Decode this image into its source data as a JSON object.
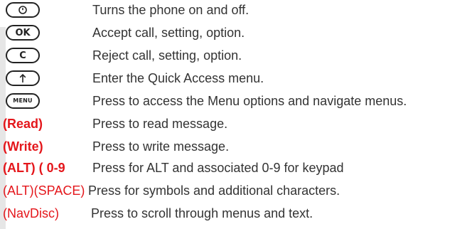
{
  "rows": [
    {
      "key_icon": "power-icon",
      "description": "Turns the phone on and off."
    },
    {
      "key_label": "OK",
      "description": "Accept call, setting, option."
    },
    {
      "key_label": "C",
      "description": "Reject call, setting, option."
    },
    {
      "key_icon": "up-arrow-icon",
      "description": "Enter the Quick Access menu."
    },
    {
      "key_label": "MENU",
      "description": "Press to access the Menu options and navigate menus."
    },
    {
      "label": "(Read)",
      "description": "Press to read message."
    },
    {
      "label": "(Write)",
      "description": "Press to write message."
    },
    {
      "label": "(ALT) ( 0-9",
      "description": "Press for ALT and associated 0-9 for keypad"
    },
    {
      "label": "(ALT)(SPACE)",
      "description": "Press for symbols and additional characters."
    },
    {
      "label": "(NavDisc)",
      "description": "Press to scroll through menus and text."
    }
  ],
  "colors": {
    "accent_red": "#e4161b",
    "text": "#333333",
    "key_outline": "#222222",
    "side_strip": "#e6e6e6"
  }
}
